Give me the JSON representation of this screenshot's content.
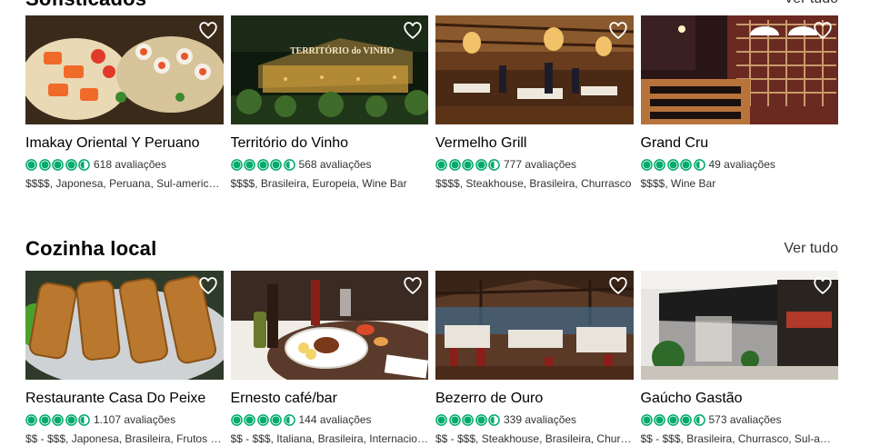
{
  "sections": [
    {
      "title": "Sofisticados",
      "view_all": "Ver tudo",
      "cards": [
        {
          "name": "Imakay Oriental Y Peruano",
          "rating": 4.5,
          "reviews": "618 avaliações",
          "meta": "$$$$, Japonesa, Peruana, Sul-americana"
        },
        {
          "name": "Território do Vinho",
          "rating": 4.5,
          "reviews": "568 avaliações",
          "meta": "$$$$, Brasileira, Europeia, Wine Bar"
        },
        {
          "name": "Vermelho Grill",
          "rating": 4.5,
          "reviews": "777 avaliações",
          "meta": "$$$$, Steakhouse, Brasileira, Churrasco"
        },
        {
          "name": "Grand Cru",
          "rating": 4.5,
          "reviews": "49 avaliações",
          "meta": "$$$$, Wine Bar"
        }
      ]
    },
    {
      "title": "Cozinha local",
      "view_all": "Ver tudo",
      "cards": [
        {
          "name": "Restaurante Casa Do Peixe",
          "rating": 4.5,
          "reviews": "1.107 avaliações",
          "meta": "$$ - $$$, Japonesa, Brasileira, Frutos do mar"
        },
        {
          "name": "Ernesto café/bar",
          "rating": 4.5,
          "reviews": "144 avaliações",
          "meta": "$$ - $$$, Italiana, Brasileira, Internacional"
        },
        {
          "name": "Bezerro de Ouro",
          "rating": 4.5,
          "reviews": "339 avaliações",
          "meta": "$$ - $$$, Steakhouse, Brasileira, Churrasco"
        },
        {
          "name": "Gaúcho Gastão",
          "rating": 4.5,
          "reviews": "573 avaliações",
          "meta": "$$ - $$$, Brasileira, Churrasco, Sul-americana"
        }
      ]
    }
  ],
  "colors": {
    "bubble": "#00aa6c",
    "heart": "#ffffff"
  },
  "icons": {
    "save": "heart-icon",
    "rating": "rating-bubble-icon"
  }
}
